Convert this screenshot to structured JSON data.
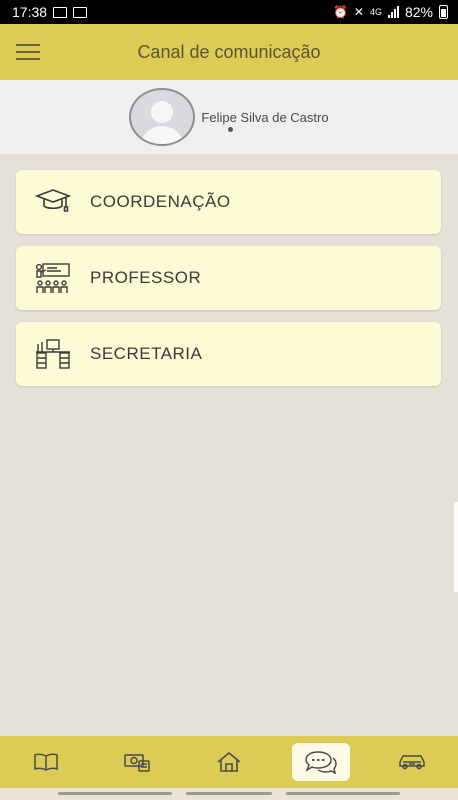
{
  "status_bar": {
    "time": "17:38",
    "battery": "82%",
    "network": "4G"
  },
  "app_bar": {
    "title": "Canal de comunicação"
  },
  "profile": {
    "name": "Felipe Silva de Castro"
  },
  "channels": [
    {
      "label": "COORDENAÇÃO",
      "icon": "graduation-cap-icon"
    },
    {
      "label": "PROFESSOR",
      "icon": "teacher-classroom-icon"
    },
    {
      "label": "SECRETARIA",
      "icon": "office-desk-icon"
    }
  ],
  "bottom_nav": [
    {
      "icon": "book-icon",
      "active": false
    },
    {
      "icon": "money-icon",
      "active": false
    },
    {
      "icon": "home-icon",
      "active": false
    },
    {
      "icon": "chat-bubbles-icon",
      "active": true
    },
    {
      "icon": "car-icon",
      "active": false
    }
  ],
  "colors": {
    "accent": "#dccb54",
    "card": "#fdfbd6",
    "background": "#e5e0d8"
  }
}
